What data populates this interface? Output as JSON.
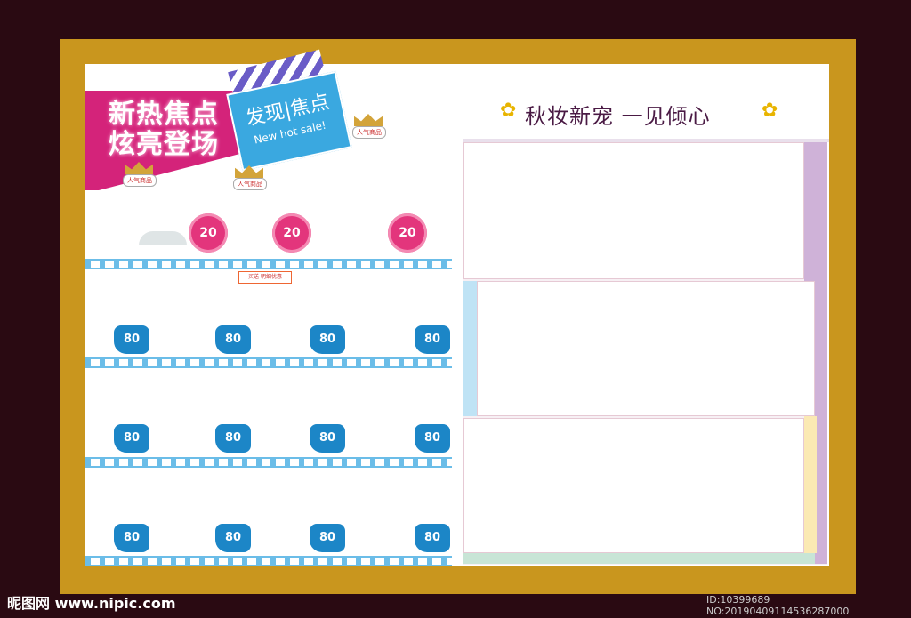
{
  "banner": {
    "promo_line1": "新热焦点",
    "promo_line2": "炫亮登场",
    "clap_title": "发现|焦点",
    "clap_sub": "New hot sale!",
    "crown_label": "人气商品"
  },
  "badges": {
    "twenty": "20",
    "eighty": "80"
  },
  "gift_tag": "买送 明细优惠",
  "right": {
    "title": "秋妆新宠  一见倾心"
  },
  "watermark": {
    "left": "昵图网 www.nipic.com",
    "right": "ID:10399689 NO:20190409114536287000"
  },
  "colors": {
    "frame": "#c9961e",
    "magenta": "#d4237a",
    "blue": "#1c86c7",
    "background": "#2a0a12"
  }
}
